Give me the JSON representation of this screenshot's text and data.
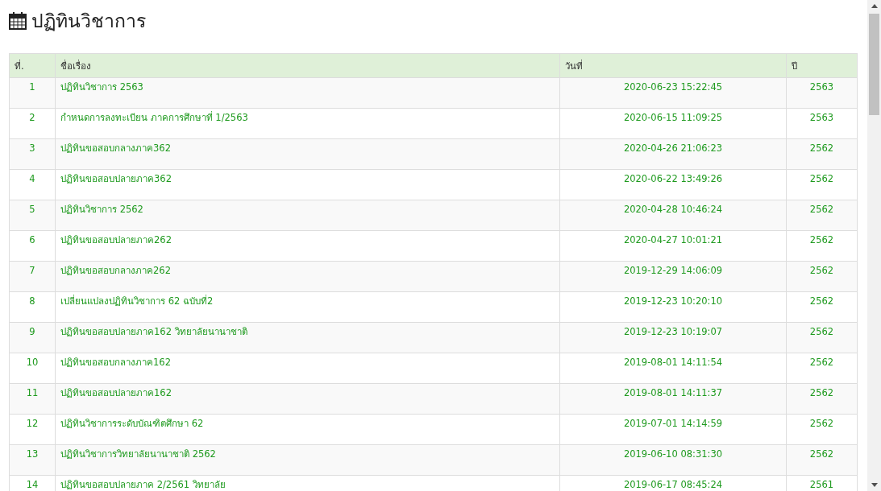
{
  "heading": "ปฏิทินวิชาการ",
  "table": {
    "columns": [
      "ที่.",
      "ชื่อเรื่อง",
      "วันที่",
      "ปี"
    ],
    "rows": [
      {
        "no": "1",
        "title": "ปฏิทินวิชาการ 2563",
        "date": "2020-06-23 15:22:45",
        "year": "2563"
      },
      {
        "no": "2",
        "title": "กำหนดการลงทะเบียน ภาคการศึกษาที่ 1/2563",
        "date": "2020-06-15 11:09:25",
        "year": "2563"
      },
      {
        "no": "3",
        "title": "ปฏิทินขอสอบกลางภาค362",
        "date": "2020-04-26 21:06:23",
        "year": "2562"
      },
      {
        "no": "4",
        "title": "ปฏิทินขอสอบปลายภาค362",
        "date": "2020-06-22 13:49:26",
        "year": "2562"
      },
      {
        "no": "5",
        "title": "ปฏิทินวิชาการ 2562",
        "date": "2020-04-28 10:46:24",
        "year": "2562"
      },
      {
        "no": "6",
        "title": "ปฏิทินขอสอบปลายภาค262",
        "date": "2020-04-27 10:01:21",
        "year": "2562"
      },
      {
        "no": "7",
        "title": "ปฏิทินขอสอบกลางภาค262",
        "date": "2019-12-29 14:06:09",
        "year": "2562"
      },
      {
        "no": "8",
        "title": "เปลี่ยนแปลงปฏิทินวิชาการ 62 ฉบับที่2",
        "date": "2019-12-23 10:20:10",
        "year": "2562"
      },
      {
        "no": "9",
        "title": "ปฏิทินขอสอบปลายภาค162 วิทยาลัยนานาชาติ",
        "date": "2019-12-23 10:19:07",
        "year": "2562"
      },
      {
        "no": "10",
        "title": "ปฏิทินขอสอบกลางภาค162",
        "date": "2019-08-01 14:11:54",
        "year": "2562"
      },
      {
        "no": "11",
        "title": "ปฏิทินขอสอบปลายภาค162",
        "date": "2019-08-01 14:11:37",
        "year": "2562"
      },
      {
        "no": "12",
        "title": "ปฏิทินวิชาการระดับบัณฑิตศึกษา 62",
        "date": "2019-07-01 14:14:59",
        "year": "2562"
      },
      {
        "no": "13",
        "title": "ปฏิทินวิชาการวิทยาลัยนานาชาติ 2562",
        "date": "2019-06-10 08:31:30",
        "year": "2562"
      },
      {
        "no": "14",
        "title": "ปฏิทินขอสอบปลายภาค 2/2561 วิทยาลัย",
        "date": "2019-06-17 08:45:24",
        "year": "2561"
      }
    ]
  }
}
